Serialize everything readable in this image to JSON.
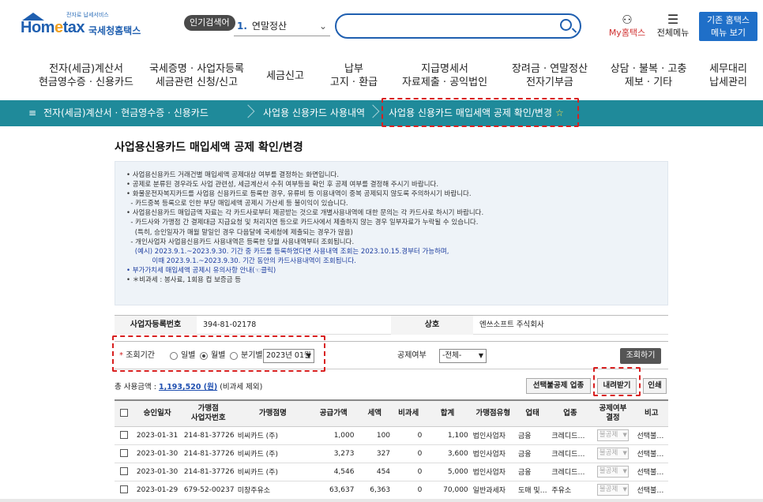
{
  "header": {
    "logo_tagline": "전자로 납세서비스",
    "logo_text_a": "Hom",
    "logo_text_e": "e",
    "logo_text_b": "tax",
    "logo_korean": "국세청홈택스",
    "popular_label": "인기검색어",
    "popular_rank": "1.",
    "popular_term": "연말정산",
    "search_placeholder": "",
    "my_hometax": "My홈택스",
    "all_menu": "전체메뉴",
    "old_hometax_line1": "기존 홈택스",
    "old_hometax_line2": "메뉴 보기"
  },
  "gnb": [
    {
      "line1": "전자(세금)계산서",
      "line2": "현금영수증 · 신용카드"
    },
    {
      "line1": "국세증명 · 사업자등록",
      "line2": "세금관련 신청/신고"
    },
    {
      "line1": "세금신고",
      "line2": ""
    },
    {
      "line1": "납부",
      "line2": "고지 · 환급"
    },
    {
      "line1": "지급명세서",
      "line2": "자료제출 · 공익법인"
    },
    {
      "line1": "장려금 · 연말정산",
      "line2": "전자기부금"
    },
    {
      "line1": "상담 · 불복 · 고충",
      "line2": "제보 · 기타"
    },
    {
      "line1": "세무대리",
      "line2": "납세관리"
    }
  ],
  "breadcrumb": {
    "menu_icon": "≡",
    "level1": "전자(세금)계산서 · 현금영수증 · 신용카드",
    "level2": "사업용 신용카드 사용내역",
    "level3": "사업용 신용카드 매입세액 공제 확인/변경",
    "star": "☆"
  },
  "page_title": "사업용신용카드 매입세액 공제 확인/변경",
  "notice": [
    {
      "t": "• 사업용신용카드 거래건별 매입세액 공제대상 여부를 결정하는 화면입니다.",
      "c": ""
    },
    {
      "t": "• 공제로 분류된 경우라도 사업 관련성, 세금계산서 수취 여부등을 확인 후 공제 여부를 결정해 주시기 바랍니다.",
      "c": ""
    },
    {
      "t": "• 화물운전자복지카드를 사업용 신용카드로 등록한 경우, 유류비 등 이용내역이 중복 공제되지 않도록 주의하시기 바랍니다.",
      "c": ""
    },
    {
      "t": "  - 카드중복 등록으로 인한 부당 매입세액 공제시 가산세 등 불이익이 있습니다.",
      "c": ""
    },
    {
      "t": "• 사업용신용카드 매입금액 자료는 각 카드사로부터 제공받는 것으로 개별사용내역에 대한 문의는 각 카드사로 하시기 바랍니다.",
      "c": ""
    },
    {
      "t": "  - 카드사와 가맹점 간 결제대금 지급요청 및 처리지연 등으로 카드사에서 제출하지 않는 경우 일부자료가 누락될 수 있습니다.",
      "c": ""
    },
    {
      "t": "    (특히, 승인일자가 매월 말일인 경우 다음달에 국세청에 제출되는 경우가 많음)",
      "c": ""
    },
    {
      "t": "  - 개인사업자 사업용신용카드 사용내역은 등록한 당월 사용내역부터 조회됩니다.",
      "c": ""
    },
    {
      "t": "    (예시) 2023.9.1.~2023.9.30. 기간 중 카드를 등록하였다면 사용내역 조회는 2023.10.15.경부터 가능하며,",
      "c": "blue"
    },
    {
      "t": "            이때 2023.9.1.~2023.9.30. 기간 동안의 카드사용내역이 조회됩니다.",
      "c": "blue"
    },
    {
      "t": "• 부가가치세 매입세액 공제시 유의사항 안내(☜클릭)",
      "c": "blue"
    },
    {
      "t": "• ＊비과세 : 봉사료, 1회용 컵 보증금 등",
      "c": ""
    }
  ],
  "business": {
    "reg_label": "사업자등록번호",
    "reg_value": "394-81-02178",
    "name_label": "상호",
    "name_value": "엔쓰소프트 주식회사"
  },
  "filter": {
    "period_label": "조회기간",
    "required_mark": "*",
    "opt_daily": "일별",
    "opt_monthly": "월별",
    "opt_quarterly": "분기별",
    "month_value": "2023년 01월",
    "deduct_label": "공제여부",
    "deduct_value": "-전체-",
    "query_button": "조회하기"
  },
  "total": {
    "label": "총 사용금액 : ",
    "amount": "1,193,520 (원)",
    "note": " (비과세 제외)"
  },
  "actions": {
    "bulk_nondeduct": "선택불공제 업종",
    "download": "내려받기",
    "print": "인쇄"
  },
  "table": {
    "headers": [
      "",
      "승인일자",
      "가맹점\n사업자번호",
      "가맹점명",
      "공급가액",
      "세액",
      "비과세",
      "합계",
      "가맹점유형",
      "업태",
      "업종",
      "공제여부\n결정",
      "비고"
    ],
    "rows": [
      [
        "2023-01-31",
        "214-81-37726",
        "비씨카드 (주)",
        "1,000",
        "100",
        "0",
        "1,100",
        "법인사업자",
        "금융",
        "크레디드…",
        "불공제",
        "선택불…"
      ],
      [
        "2023-01-30",
        "214-81-37726",
        "비씨카드 (주)",
        "3,273",
        "327",
        "0",
        "3,600",
        "법인사업자",
        "금융",
        "크레디드…",
        "불공제",
        "선택불…"
      ],
      [
        "2023-01-30",
        "214-81-37726",
        "비씨카드 (주)",
        "4,546",
        "454",
        "0",
        "5,000",
        "법인사업자",
        "금융",
        "크레디드…",
        "불공제",
        "선택불…"
      ],
      [
        "2023-01-29",
        "679-52-00237",
        "미창주유소",
        "63,637",
        "6,363",
        "0",
        "70,000",
        "일반과세자",
        "도매 및…",
        "주유소",
        "불공제",
        "선택불…"
      ]
    ]
  },
  "colors": {
    "brand_blue": "#1f5fb0",
    "crumb_teal": "#1f8a9a",
    "highlight_red": "#d82020"
  }
}
